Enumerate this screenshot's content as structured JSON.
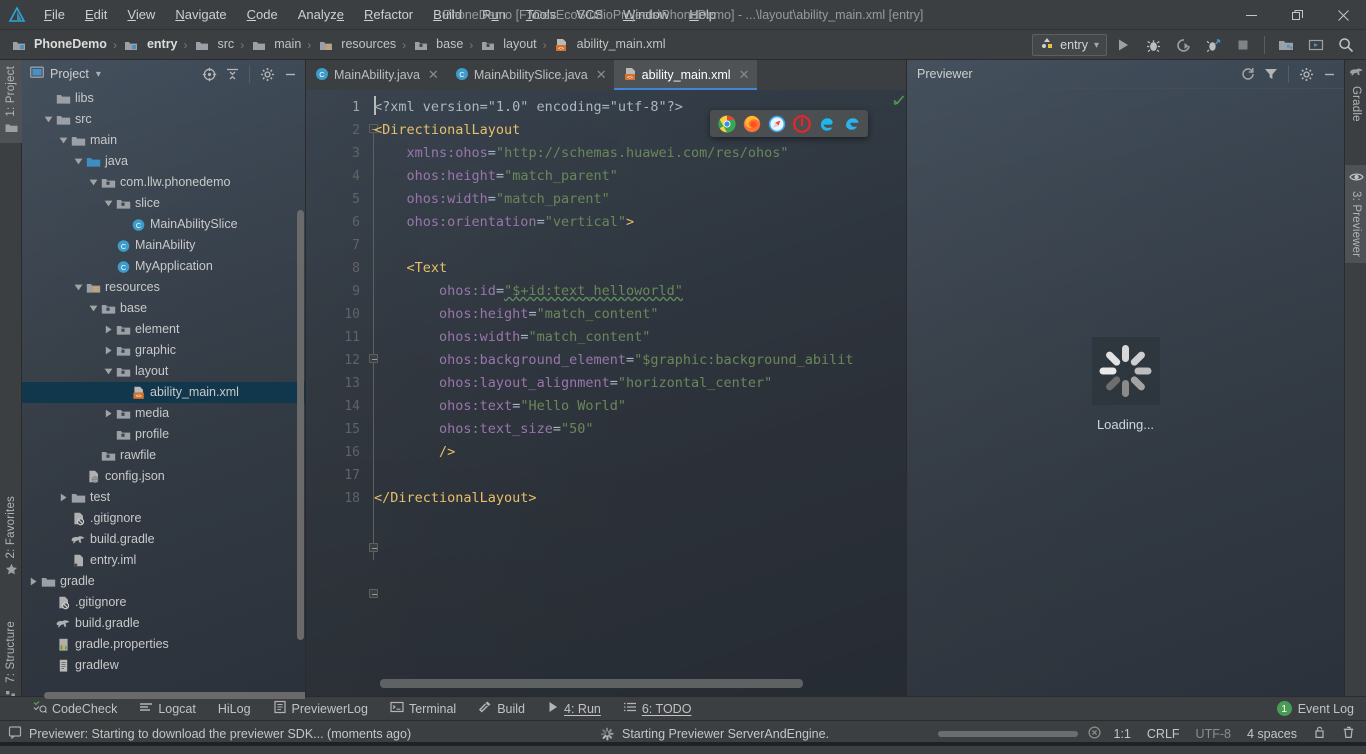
{
  "window": {
    "title": "PhoneDemo [F:\\DevEcoStudioProjects\\PhoneDemo] - ...\\layout\\ability_main.xml [entry]",
    "minimize": "—",
    "restore": "❐",
    "close": "✕"
  },
  "menu": [
    {
      "label": "File"
    },
    {
      "label": "Edit"
    },
    {
      "label": "View"
    },
    {
      "label": "Navigate"
    },
    {
      "label": "Code"
    },
    {
      "label": "Analyze"
    },
    {
      "label": "Refactor"
    },
    {
      "label": "Build"
    },
    {
      "label": "Run"
    },
    {
      "label": "Tools"
    },
    {
      "label": "VCS"
    },
    {
      "label": "Window"
    },
    {
      "label": "Help"
    }
  ],
  "breadcrumb": [
    {
      "label": "PhoneDemo",
      "icon": "module-icon",
      "bold": true
    },
    {
      "label": "entry",
      "icon": "module-icon",
      "bold": true
    },
    {
      "label": "src",
      "icon": "folder-icon",
      "bold": false
    },
    {
      "label": "main",
      "icon": "folder-icon",
      "bold": false
    },
    {
      "label": "resources",
      "icon": "resources-folder-icon",
      "bold": false
    },
    {
      "label": "base",
      "icon": "res-folder-icon",
      "bold": false
    },
    {
      "label": "layout",
      "icon": "res-folder-icon",
      "bold": false
    },
    {
      "label": "ability_main.xml",
      "icon": "xml-layout-icon",
      "bold": false
    }
  ],
  "toolbar": {
    "run_config": "entry",
    "run_config_icon": "device-icon",
    "chevron": "▾",
    "buttons": [
      {
        "name": "run-button",
        "icon": "play-icon"
      },
      {
        "name": "debug-button",
        "icon": "bug-icon"
      },
      {
        "name": "attach-debugger-button",
        "icon": "attach-icon"
      },
      {
        "name": "profile-button",
        "icon": "profiler-icon"
      },
      {
        "name": "stop-button",
        "icon": "stop-icon"
      },
      {
        "name": "device-manager-button",
        "icon": "device-manager-icon"
      },
      {
        "name": "sdk-manager-button",
        "icon": "sdk-manager-icon"
      },
      {
        "name": "search-everywhere-button",
        "icon": "search-icon"
      }
    ]
  },
  "left_stripe": [
    {
      "label": "1: Project",
      "icon": "project-folder-icon",
      "selected": true
    },
    {
      "label": "2: Favorites",
      "icon": "star-icon",
      "selected": false
    },
    {
      "label": "7: Structure",
      "icon": "structure-icon",
      "selected": false
    }
  ],
  "right_stripe": [
    {
      "label": "Gradle",
      "icon": "gradle-elephant-icon",
      "selected": false
    },
    {
      "label": "3: Previewer",
      "icon": "eye-icon",
      "selected": true
    }
  ],
  "project_panel": {
    "title": "Project",
    "title_icon": "project-icon",
    "chevron": "▾",
    "header_buttons": [
      {
        "name": "select-opened-file-button",
        "icon": "target-icon"
      },
      {
        "name": "collapse-all-button",
        "icon": "collapse-all-icon"
      },
      {
        "name": "settings-button",
        "icon": "gear-icon"
      },
      {
        "name": "hide-button",
        "icon": "minimize-icon"
      }
    ],
    "tree": [
      {
        "label": "libs",
        "icon": "folder-icon",
        "depth": 2,
        "twisty": "none"
      },
      {
        "label": "src",
        "icon": "folder-icon",
        "depth": 2,
        "twisty": "open"
      },
      {
        "label": "main",
        "icon": "folder-icon",
        "depth": 3,
        "twisty": "open"
      },
      {
        "label": "java",
        "icon": "java-folder-icon",
        "depth": 4,
        "twisty": "open"
      },
      {
        "label": "com.llw.phonedemo",
        "icon": "package-icon",
        "depth": 5,
        "twisty": "open"
      },
      {
        "label": "slice",
        "icon": "package-icon",
        "depth": 6,
        "twisty": "open"
      },
      {
        "label": "MainAbilitySlice",
        "icon": "class-icon",
        "depth": 7,
        "twisty": "none"
      },
      {
        "label": "MainAbility",
        "icon": "class-icon",
        "depth": 6,
        "twisty": "none"
      },
      {
        "label": "MyApplication",
        "icon": "class-icon",
        "depth": 6,
        "twisty": "none"
      },
      {
        "label": "resources",
        "icon": "resources-folder-icon",
        "depth": 4,
        "twisty": "open"
      },
      {
        "label": "base",
        "icon": "res-folder-icon",
        "depth": 5,
        "twisty": "open"
      },
      {
        "label": "element",
        "icon": "res-folder-icon",
        "depth": 6,
        "twisty": "closed"
      },
      {
        "label": "graphic",
        "icon": "res-folder-icon",
        "depth": 6,
        "twisty": "closed"
      },
      {
        "label": "layout",
        "icon": "res-folder-icon",
        "depth": 6,
        "twisty": "open"
      },
      {
        "label": "ability_main.xml",
        "icon": "xml-layout-icon",
        "depth": 7,
        "twisty": "none",
        "selected": true
      },
      {
        "label": "media",
        "icon": "res-folder-icon",
        "depth": 6,
        "twisty": "closed"
      },
      {
        "label": "profile",
        "icon": "res-folder-icon",
        "depth": 6,
        "twisty": "none"
      },
      {
        "label": "rawfile",
        "icon": "res-folder-icon",
        "depth": 5,
        "twisty": "none"
      },
      {
        "label": "config.json",
        "icon": "json-icon",
        "depth": 4,
        "twisty": "none"
      },
      {
        "label": "test",
        "icon": "folder-icon",
        "depth": 3,
        "twisty": "closed"
      },
      {
        "label": ".gitignore",
        "icon": "gitignore-icon",
        "depth": 3,
        "twisty": "none"
      },
      {
        "label": "build.gradle",
        "icon": "gradle-file-icon",
        "depth": 3,
        "twisty": "none"
      },
      {
        "label": "entry.iml",
        "icon": "iml-icon",
        "depth": 3,
        "twisty": "none"
      },
      {
        "label": "gradle",
        "icon": "folder-icon",
        "depth": 1,
        "twisty": "closed"
      },
      {
        "label": ".gitignore",
        "icon": "gitignore-icon",
        "depth": 2,
        "twisty": "none"
      },
      {
        "label": "build.gradle",
        "icon": "gradle-file-icon",
        "depth": 2,
        "twisty": "none"
      },
      {
        "label": "gradle.properties",
        "icon": "properties-icon",
        "depth": 2,
        "twisty": "none"
      },
      {
        "label": "gradlew",
        "icon": "script-icon",
        "depth": 2,
        "twisty": "none"
      }
    ]
  },
  "editor": {
    "tabs": [
      {
        "label": "MainAbility.java",
        "icon": "class-icon",
        "active": false,
        "close": "✕"
      },
      {
        "label": "MainAbilitySlice.java",
        "icon": "class-icon",
        "active": false,
        "close": "✕"
      },
      {
        "label": "ability_main.xml",
        "icon": "xml-layout-icon",
        "active": true,
        "close": "✕"
      }
    ],
    "inspection_icon": "inspection-ok-icon",
    "lines": [
      {
        "n": 1,
        "tokens": [
          {
            "t": "pi",
            "v": "<?xml version=\"1.0\" encoding=\"utf-8\"?>"
          }
        ]
      },
      {
        "n": 2,
        "tokens": [
          {
            "t": "tag",
            "v": "<DirectionalLayout"
          }
        ]
      },
      {
        "n": 3,
        "tokens": [
          {
            "t": "sp",
            "v": "    "
          },
          {
            "t": "attr",
            "v": "xmlns:ohos"
          },
          {
            "t": "eq",
            "v": "="
          },
          {
            "t": "str",
            "v": "\"http://schemas.huawei.com/res/ohos\""
          }
        ]
      },
      {
        "n": 4,
        "tokens": [
          {
            "t": "sp",
            "v": "    "
          },
          {
            "t": "attr",
            "v": "ohos:height"
          },
          {
            "t": "eq",
            "v": "="
          },
          {
            "t": "str",
            "v": "\"match_parent\""
          }
        ]
      },
      {
        "n": 5,
        "tokens": [
          {
            "t": "sp",
            "v": "    "
          },
          {
            "t": "attr",
            "v": "ohos:width"
          },
          {
            "t": "eq",
            "v": "="
          },
          {
            "t": "str",
            "v": "\"match_parent\""
          }
        ]
      },
      {
        "n": 6,
        "tokens": [
          {
            "t": "sp",
            "v": "    "
          },
          {
            "t": "attr",
            "v": "ohos:orientation"
          },
          {
            "t": "eq",
            "v": "="
          },
          {
            "t": "str",
            "v": "\"vertical\""
          },
          {
            "t": "tag",
            "v": ">"
          }
        ]
      },
      {
        "n": 7,
        "tokens": []
      },
      {
        "n": 8,
        "tokens": [
          {
            "t": "sp",
            "v": "    "
          },
          {
            "t": "tag",
            "v": "<Text"
          }
        ]
      },
      {
        "n": 9,
        "tokens": [
          {
            "t": "sp",
            "v": "        "
          },
          {
            "t": "attr",
            "v": "ohos:id"
          },
          {
            "t": "eq",
            "v": "="
          },
          {
            "t": "strw",
            "v": "\"$+id:text_helloworld\""
          }
        ]
      },
      {
        "n": 10,
        "tokens": [
          {
            "t": "sp",
            "v": "        "
          },
          {
            "t": "attr",
            "v": "ohos:height"
          },
          {
            "t": "eq",
            "v": "="
          },
          {
            "t": "str",
            "v": "\"match_content\""
          }
        ]
      },
      {
        "n": 11,
        "tokens": [
          {
            "t": "sp",
            "v": "        "
          },
          {
            "t": "attr",
            "v": "ohos:width"
          },
          {
            "t": "eq",
            "v": "="
          },
          {
            "t": "str",
            "v": "\"match_content\""
          }
        ]
      },
      {
        "n": 12,
        "tokens": [
          {
            "t": "sp",
            "v": "        "
          },
          {
            "t": "attr",
            "v": "ohos:background_element"
          },
          {
            "t": "eq",
            "v": "="
          },
          {
            "t": "str",
            "v": "\"$graphic:background_abilit"
          }
        ]
      },
      {
        "n": 13,
        "tokens": [
          {
            "t": "sp",
            "v": "        "
          },
          {
            "t": "attr",
            "v": "ohos:layout_alignment"
          },
          {
            "t": "eq",
            "v": "="
          },
          {
            "t": "str",
            "v": "\"horizontal_center\""
          }
        ]
      },
      {
        "n": 14,
        "tokens": [
          {
            "t": "sp",
            "v": "        "
          },
          {
            "t": "attr",
            "v": "ohos:text"
          },
          {
            "t": "eq",
            "v": "="
          },
          {
            "t": "str",
            "v": "\"Hello World\""
          }
        ]
      },
      {
        "n": 15,
        "tokens": [
          {
            "t": "sp",
            "v": "        "
          },
          {
            "t": "attr",
            "v": "ohos:text_size"
          },
          {
            "t": "eq",
            "v": "="
          },
          {
            "t": "str",
            "v": "\"50\""
          }
        ]
      },
      {
        "n": 16,
        "tokens": [
          {
            "t": "sp",
            "v": "        "
          },
          {
            "t": "tag",
            "v": "/>"
          }
        ]
      },
      {
        "n": 17,
        "tokens": []
      },
      {
        "n": 18,
        "tokens": [
          {
            "t": "tag",
            "v": "</DirectionalLayout>"
          }
        ]
      }
    ]
  },
  "browser_popup": {
    "browsers": [
      {
        "name": "chrome-icon",
        "label": "Chrome"
      },
      {
        "name": "firefox-icon",
        "label": "Firefox"
      },
      {
        "name": "safari-icon",
        "label": "Safari"
      },
      {
        "name": "opera-icon",
        "label": "Opera"
      },
      {
        "name": "internet-explorer-icon",
        "label": "Internet Explorer"
      },
      {
        "name": "edge-icon",
        "label": "Edge"
      }
    ]
  },
  "previewer": {
    "title": "Previewer",
    "header_buttons": [
      {
        "name": "refresh-button",
        "icon": "refresh-icon"
      },
      {
        "name": "filter-button",
        "icon": "filter-icon"
      },
      {
        "name": "settings-button",
        "icon": "gear-icon"
      },
      {
        "name": "hide-button",
        "icon": "minimize-icon"
      }
    ],
    "loading_label": "Loading...",
    "loading_icon": "spinner-icon"
  },
  "bottom_bar": {
    "windows": [
      {
        "label": "CodeCheck",
        "icon": "codecheck-icon"
      },
      {
        "label": "Logcat",
        "icon": "logcat-icon"
      },
      {
        "label": "HiLog",
        "icon": "hilog-icon"
      },
      {
        "label": "PreviewerLog",
        "icon": "previewerlog-icon"
      },
      {
        "label": "Terminal",
        "icon": "terminal-icon"
      },
      {
        "label": "Build",
        "icon": "build-hammer-icon"
      },
      {
        "label": "4: Run",
        "icon": "play-icon"
      },
      {
        "label": "6: TODO",
        "icon": "todo-icon"
      }
    ],
    "event_log": {
      "label": "Event Log",
      "count": "1",
      "color": "#499c54"
    }
  },
  "status_bar": {
    "message_icon": "balloon-icon",
    "message": "Previewer: Starting to download the previewer SDK... (moments ago)",
    "task_icon": "spinner-icon",
    "task": "Starting Previewer ServerAndEngine.",
    "cancel_icon": "cancel-icon",
    "caret": "1:1",
    "line_separator": "CRLF",
    "encoding": "UTF-8",
    "indent": "4 spaces",
    "lock_icon": "lock-icon",
    "trash_icon": "trash-icon"
  },
  "colors": {
    "panel_bg": "#3c3f41",
    "editor_bg": "#2b2b2b",
    "accent_blue": "#3d87d5",
    "selection_blue": "#11374c",
    "tag_orange": "#e8bf6a",
    "attr_purple": "#9876aa",
    "string_green": "#6a8759",
    "badge_green": "#499c54"
  }
}
